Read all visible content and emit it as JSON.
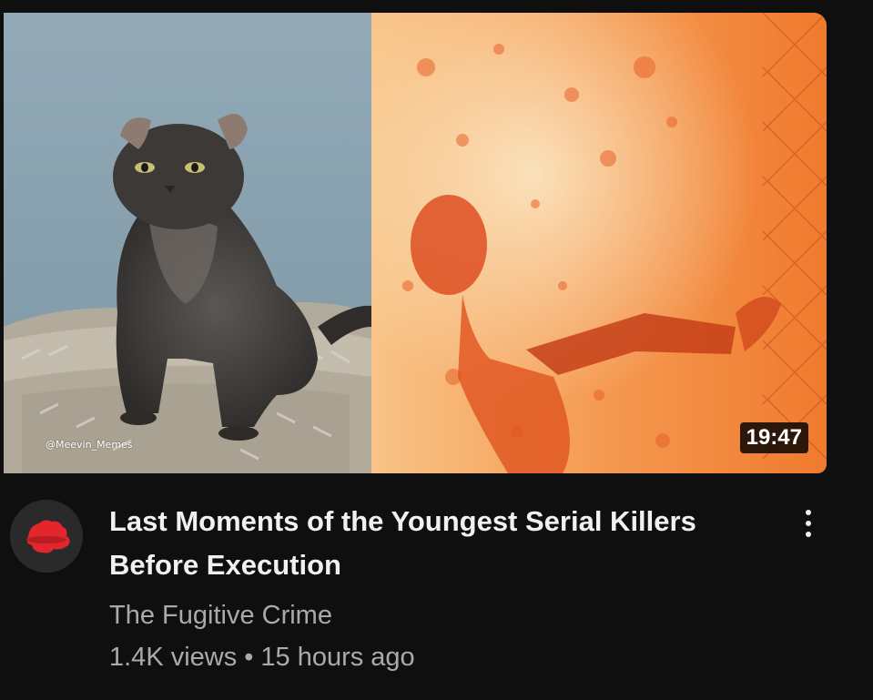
{
  "video": {
    "title": "Last Moments of the Youngest Serial Killers Before Execution",
    "duration": "19:47",
    "thumbnail_watermark": "@Meevin_Memes",
    "channel": "The Fugitive Crime",
    "views": "1.4K views",
    "separator": "•",
    "age": "15 hours ago"
  },
  "icons": {
    "avatar": "red-hat-logo-icon",
    "menu": "more-vertical-icon"
  },
  "colors": {
    "background": "#0f0f0f",
    "title_text": "#f1f1f1",
    "secondary_text": "#aaaaaa",
    "avatar_accent": "#e3262b",
    "thumbnail_orange": "#f07a2e"
  }
}
